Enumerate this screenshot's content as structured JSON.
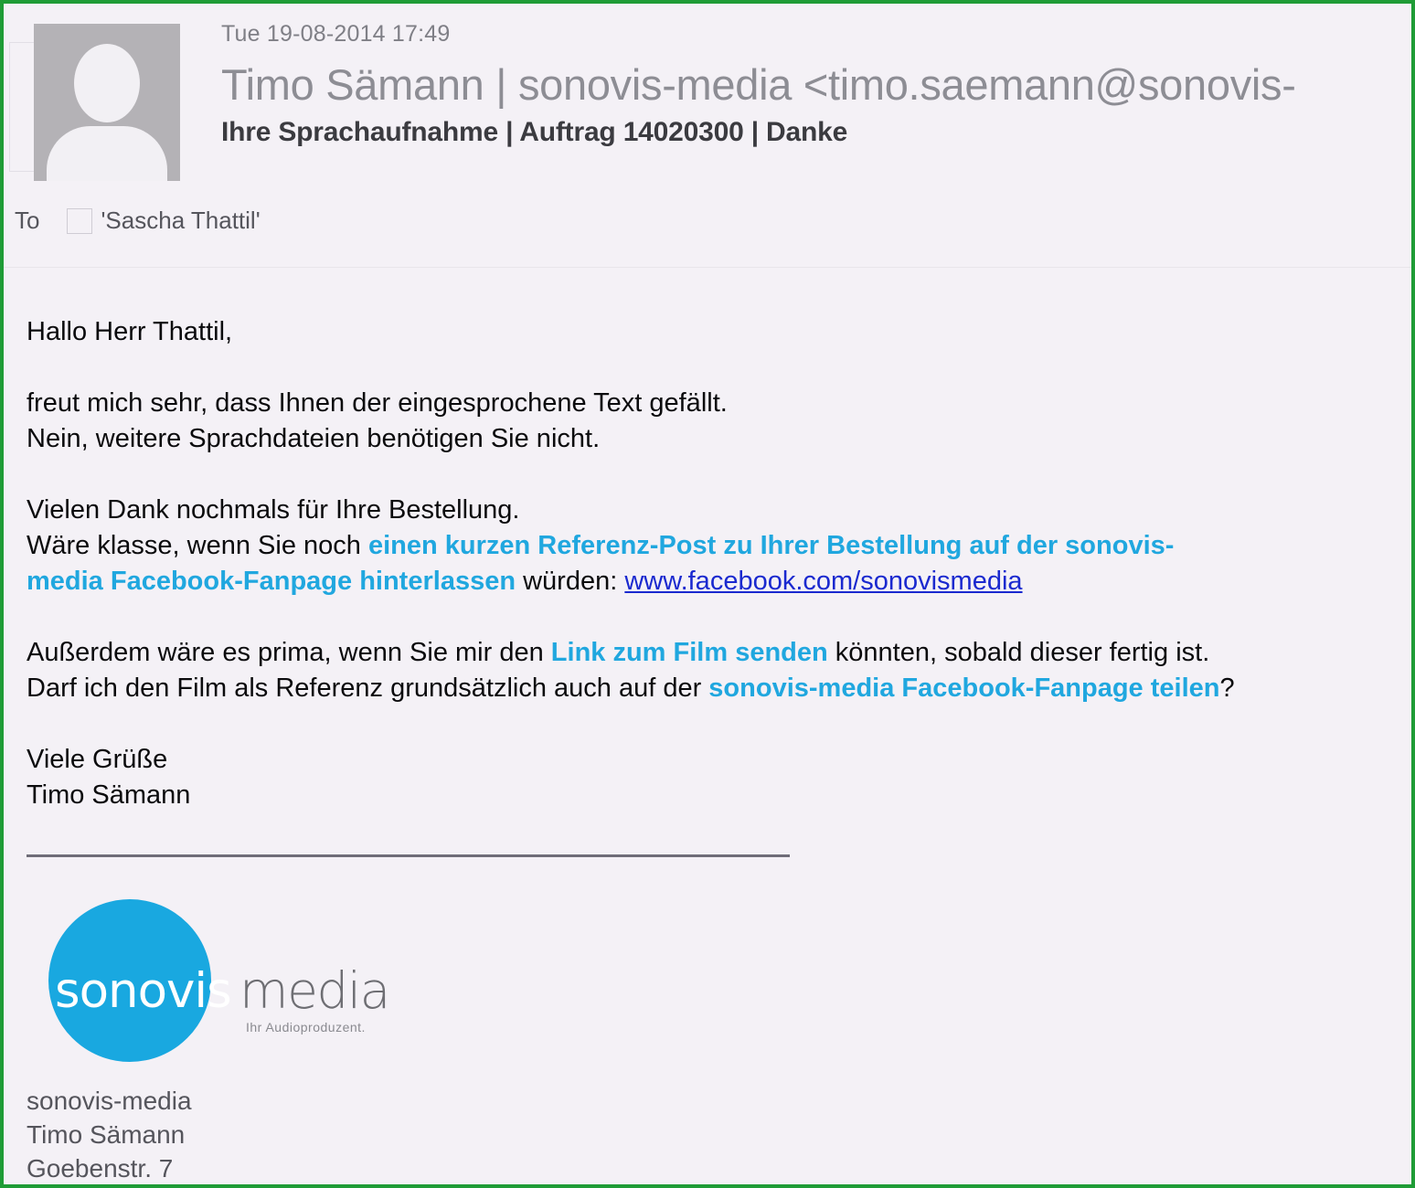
{
  "email": {
    "date": "Tue 19-08-2014 17:49",
    "from": "Timo Sämann | sonovis-media <timo.saemann@sonovis-",
    "subject": "Ihre Sprachaufnahme | Auftrag 14020300 | Danke",
    "to_label": "To",
    "to_recipient": "'Sascha Thattil'",
    "avatar_alt": "contact-photo-placeholder"
  },
  "body": {
    "greeting": "Hallo Herr Thattil,",
    "p1_line1": "freut mich sehr, dass Ihnen der eingesprochene Text gefällt.",
    "p1_line2": "Nein, weitere Sprachdateien benötigen Sie nicht.",
    "p2_line1": "Vielen Dank nochmals für Ihre Bestellung.",
    "p2_line2_pre": "Wäre klasse, wenn Sie noch ",
    "p2_line2_hl": "einen kurzen Referenz-Post zu Ihrer Bestellung auf der sonovis-",
    "p2_line3_hl": "media Facebook-Fanpage hinterlassen",
    "p2_line3_mid": " würden: ",
    "p2_line3_link": "www.facebook.com/sonovismedia",
    "p3_line1_pre": "Außerdem wäre es prima, wenn Sie mir den ",
    "p3_line1_hl": "Link zum Film senden",
    "p3_line1_post": " könnten, sobald dieser fertig ist.",
    "p3_line2_pre": "Darf ich den Film als Referenz grundsätzlich auch auf der ",
    "p3_line2_hl": "sonovis-media Facebook-Fanpage teilen",
    "p3_line2_post": "?",
    "closing_line1": "Viele Grüße",
    "closing_line2": "Timo Sämann"
  },
  "signature": {
    "logo_word_primary": "sonovis",
    "logo_word_secondary": "media",
    "logo_tagline": "Ihr Audioproduzent.",
    "company": "sonovis-media",
    "person": "Timo Sämann",
    "street": "Goebenstr. 7"
  },
  "colors": {
    "frame_green": "#1f9c36",
    "background": "#f4f1f6",
    "highlight_cyan": "#20a7df",
    "hyperlink_blue": "#1a29cf",
    "logo_cyan": "#19a8e0",
    "subject_text": "#3b3b40",
    "from_text": "#8d8d94",
    "meta_text": "#7f7f86"
  }
}
